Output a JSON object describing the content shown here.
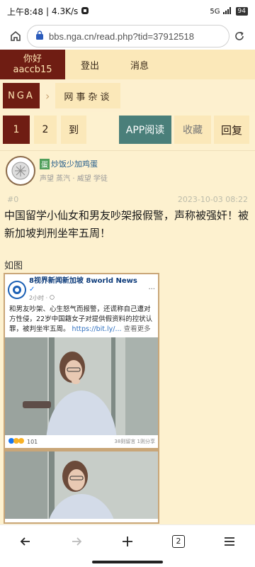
{
  "status_bar": {
    "time": "上午8:48",
    "speed": "4.3K/s",
    "signal": "5G",
    "battery": "94"
  },
  "browser": {
    "url": "bbs.nga.cn/read.php?tid=37912518",
    "tab_count": "2"
  },
  "nga_header": {
    "greeting": "你好",
    "username": "aaccb15",
    "logout_label": "登出",
    "messages_label": "消息",
    "logo_text": "NGA",
    "forum_name": "网事杂谈"
  },
  "pager": {
    "current_page": "1",
    "next_page": "2",
    "goto_label": "到",
    "app_read_label": "APP阅读",
    "favorite_label": "收藏",
    "reply_label": "回复"
  },
  "post": {
    "user_badge": "蛋",
    "username": "炒饭少加鸡蛋",
    "reputation": "声望 蒸汽 · 威望 学徒",
    "floor": "#0",
    "date": "2023-10-03 08:22",
    "title": "中国留学小仙女和男友吵架报假警，声称被强奸！被新加坡判刑坐牢五周！",
    "caption": "如图"
  },
  "embedded": {
    "page_name": "8视界新闻新加坡 8world News",
    "verified_mark": "✓",
    "time": "2小时 ·",
    "more": "···",
    "text": "和男友吵架、心生怒气而报警，还谎称自己遭对方性侵，22岁中国籍女子对提供假资料的控状认罪，被判坐牢五周。",
    "link": "https://bit.ly/...",
    "see_more": "查看更多",
    "reaction_count": "101",
    "comments_shares": "38则留言 1则分享"
  },
  "colors": {
    "nga_dark": "#6f1d13",
    "nga_bg": "#fdf1cf",
    "app_button": "#4a7f7a"
  }
}
